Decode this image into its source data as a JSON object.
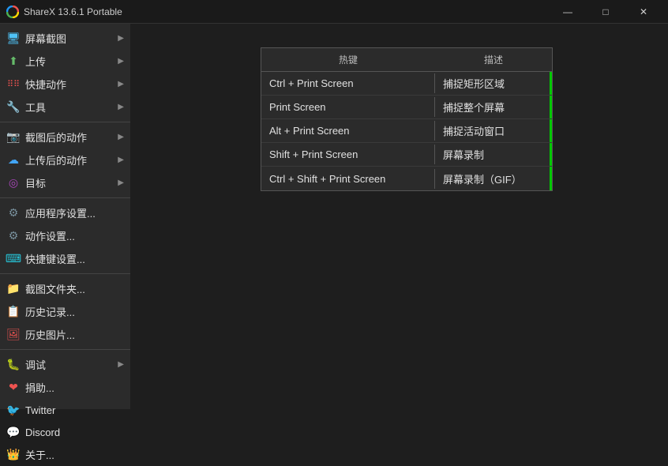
{
  "titlebar": {
    "icon": "●",
    "title": "ShareX 13.6.1 Portable",
    "minimize": "—",
    "maximize": "□",
    "close": "✕"
  },
  "menu": {
    "items": [
      {
        "id": "screenshot",
        "icon": "🖥",
        "label": "屏幕截图",
        "hasArrow": true,
        "iconClass": "icon-screenshot"
      },
      {
        "id": "upload",
        "icon": "⬆",
        "label": "上传",
        "hasArrow": true,
        "iconClass": "icon-upload"
      },
      {
        "id": "actions",
        "icon": "⋮⋮",
        "label": "快捷动作",
        "hasArrow": true,
        "iconClass": "icon-action"
      },
      {
        "id": "tools",
        "icon": "🔧",
        "label": "工具",
        "hasArrow": true,
        "iconClass": "icon-tools"
      },
      {
        "separator": true
      },
      {
        "id": "aftercapture",
        "icon": "📷",
        "label": "截图后的动作",
        "hasArrow": true,
        "iconClass": "icon-aftercapture"
      },
      {
        "id": "afterupload",
        "icon": "☁",
        "label": "上传后的动作",
        "hasArrow": true,
        "iconClass": "icon-afterupload"
      },
      {
        "id": "target",
        "icon": "◎",
        "label": "目标",
        "hasArrow": true,
        "iconClass": "icon-target"
      },
      {
        "separator2": true
      },
      {
        "id": "appsettings",
        "icon": "⚙",
        "label": "应用程序设置...",
        "hasArrow": false,
        "iconClass": "icon-settings"
      },
      {
        "id": "actionsettings",
        "icon": "⚙",
        "label": "动作设置...",
        "hasArrow": false,
        "iconClass": "icon-settings"
      },
      {
        "id": "hotkeysettings",
        "icon": "⌨",
        "label": "快捷键设置...",
        "hasArrow": false,
        "iconClass": "icon-hotkeys"
      },
      {
        "separator3": true
      },
      {
        "id": "folder",
        "icon": "📁",
        "label": "截图文件夹...",
        "hasArrow": false,
        "iconClass": "icon-folder"
      },
      {
        "id": "history",
        "icon": "📋",
        "label": "历史记录...",
        "hasArrow": false,
        "iconClass": "icon-history"
      },
      {
        "id": "imghistory",
        "icon": "🖼",
        "label": "历史图片...",
        "hasArrow": false,
        "iconClass": "icon-imghistory"
      },
      {
        "separator4": true
      },
      {
        "id": "debug",
        "icon": "🐛",
        "label": "调试",
        "hasArrow": true,
        "iconClass": "icon-debug"
      },
      {
        "id": "donate",
        "icon": "❤",
        "label": "捐助...",
        "hasArrow": false,
        "iconClass": "icon-donate"
      },
      {
        "id": "twitter",
        "icon": "🐦",
        "label": "Twitter",
        "hasArrow": false,
        "iconClass": "icon-twitter"
      },
      {
        "id": "discord",
        "icon": "💬",
        "label": "Discord",
        "hasArrow": false,
        "iconClass": "icon-discord"
      },
      {
        "id": "about",
        "icon": "👑",
        "label": "关于...",
        "hasArrow": false,
        "iconClass": "icon-about"
      }
    ]
  },
  "submenu": {
    "col_hotkey": "热键",
    "col_desc": "描述",
    "rows": [
      {
        "hotkey": "Ctrl + Print Screen",
        "desc": "捕捉矩形区域"
      },
      {
        "hotkey": "Print Screen",
        "desc": "捕捉整个屏幕"
      },
      {
        "hotkey": "Alt + Print Screen",
        "desc": "捕捉活动窗口"
      },
      {
        "hotkey": "Shift + Print Screen",
        "desc": "屏幕录制"
      },
      {
        "hotkey": "Ctrl + Shift + Print Screen",
        "desc": "屏幕录制（GIF）"
      }
    ]
  }
}
